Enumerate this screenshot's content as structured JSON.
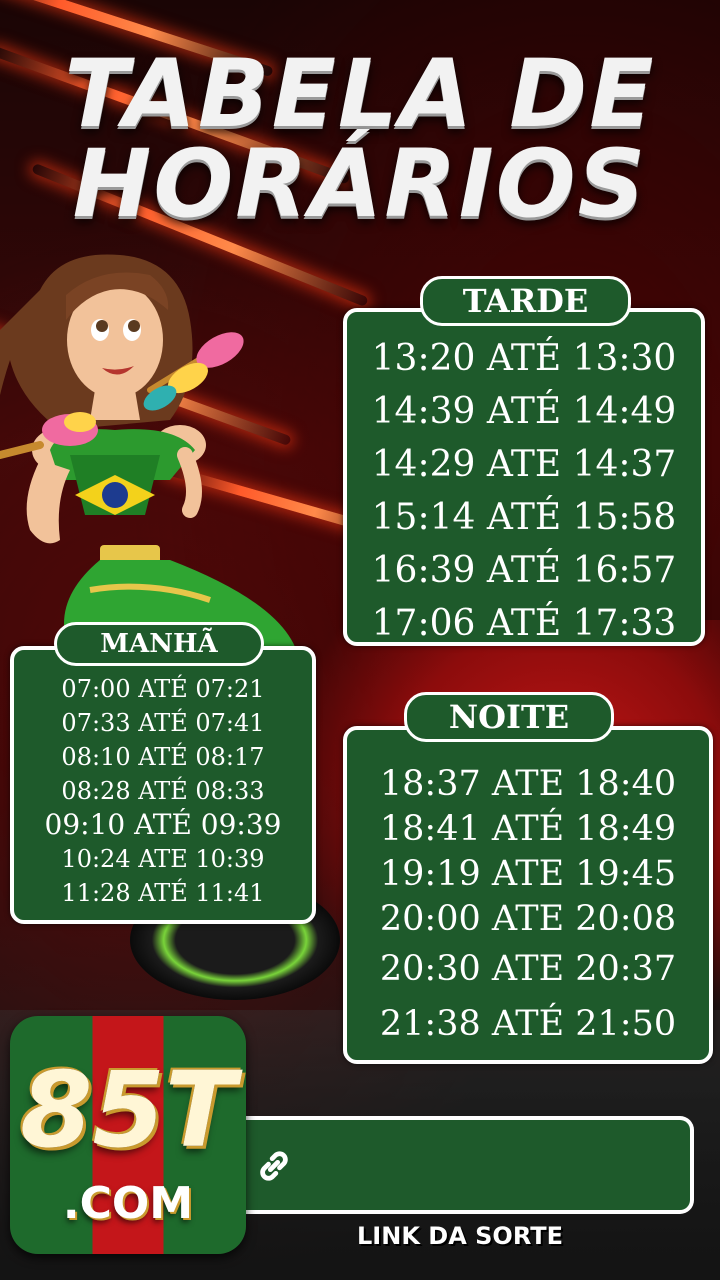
{
  "title": {
    "line1": "TABELA DE",
    "line2": "HORÁRIOS"
  },
  "tarde": {
    "label": "TARDE",
    "times": [
      "13:20 ATÉ 13:30",
      "14:39 ATÉ 14:49",
      "14:29 ATE 14:37",
      "15:14 ATÉ 15:58",
      "16:39 ATÉ 16:57",
      "17:06 ATÉ 17:33"
    ]
  },
  "manha": {
    "label": "MANHÃ",
    "times": [
      "07:00 ATÉ 07:21",
      "07:33 ATÉ 07:41",
      "08:10 ATÉ 08:17",
      "08:28 ATÉ 08:33",
      "09:10 ATÉ 09:39",
      "10:24 ATE 10:39",
      "11:28 ATÉ 11:41"
    ]
  },
  "noite": {
    "label": "NOITE",
    "times": [
      "18:37 ATE 18:40",
      "18:41 ATÉ 18:49",
      "19:19 ATE 19:45",
      "20:00 ATE 20:08",
      "20:30 ATE 20:37",
      "21:38 ATÉ 21:50"
    ]
  },
  "logo": {
    "main": "85T",
    "sub": ".COM"
  },
  "link": {
    "label": "LINK DA SORTE",
    "icon": "link-icon"
  },
  "colors": {
    "panel_green": "#1e5a2b",
    "logo_red": "#c4161a",
    "logo_green": "#1e6a2c"
  }
}
